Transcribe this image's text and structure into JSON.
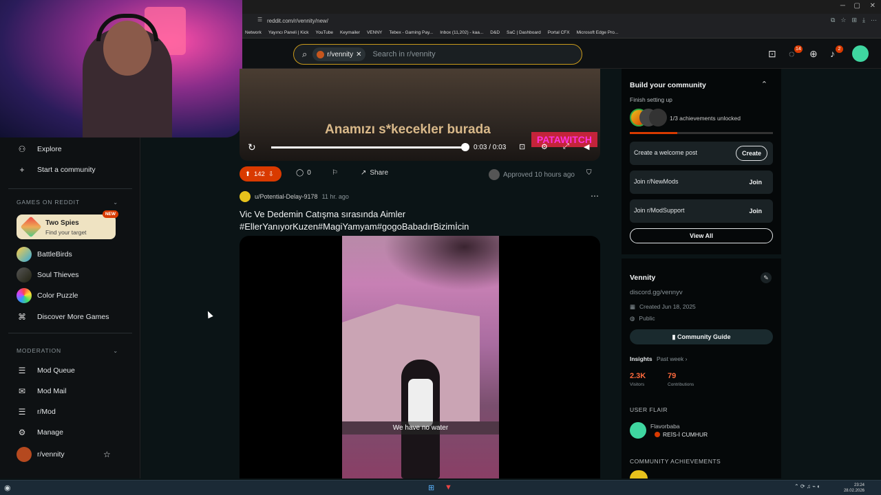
{
  "browser": {
    "url": "reddit.com/r/vennity/new/",
    "bookmarks": [
      "Network",
      "Yayıncı Paneli | Kick",
      "YouTube",
      "Keymailer",
      "VENNY",
      "Tebex - Gaming Pay...",
      "Inbox (11,202) - kaa...",
      "D&D",
      "SaC | Dashboard",
      "Portal CFX",
      "Microsoft Edge Pro..."
    ]
  },
  "header": {
    "community_chip": "r/vennity",
    "search_placeholder": "Search in r/vennity",
    "chat_badge": "14",
    "notif_badge": "2"
  },
  "sidebar": {
    "top_items": [
      {
        "label": "Explore",
        "icon": "explore-icon"
      },
      {
        "label": "Start a community",
        "icon": "plus-icon"
      }
    ],
    "games_header": "GAMES ON REDDIT",
    "featured_game": {
      "title": "Two Spies",
      "subtitle": "Find your target",
      "badge": "NEW"
    },
    "games": [
      "BattleBirds",
      "Soul Thieves",
      "Color Puzzle"
    ],
    "discover": "Discover More Games",
    "moderation_header": "MODERATION",
    "mod_items": [
      "Mod Queue",
      "Mod Mail",
      "r/Mod",
      "Manage",
      "r/vennity"
    ]
  },
  "video1": {
    "caption": "Anamızı s*kecekler burada",
    "watermark": "PATAWITCH",
    "time": "0:03 / 0:03"
  },
  "actions": {
    "votes": "142",
    "comments": "0",
    "share": "Share",
    "approved": "Approved 10 hours ago"
  },
  "post2": {
    "author": "u/Potential-Delay-9178",
    "ago": "11 hr. ago",
    "title_line1": "Vic Ve Dedemin Catışma sırasında Aimler",
    "title_line2": "#EllerYanıyorKuzen#MagiYamyam#gogoBabadırBizimİcin",
    "subtitle": "We have no water"
  },
  "right_sidebar": {
    "build_title": "Build your community",
    "finish": "Finish setting up",
    "achievements": "1/3 achievements unlocked",
    "tasks": [
      {
        "label": "Create a welcome post",
        "button": "Create"
      },
      {
        "label": "Join r/NewMods",
        "button": "Join"
      },
      {
        "label": "Join r/ModSupport",
        "button": "Join"
      }
    ],
    "view_all": "View All",
    "community_name": "Vennity",
    "community_link": "discord.gg/vennyv",
    "created": "Created Jun 18, 2025",
    "visibility": "Public",
    "guide": "Community Guide",
    "insights": "Insights",
    "period": "Past week ›",
    "visitors_num": "2.3K",
    "visitors_lbl": "Visitors",
    "contrib_num": "79",
    "contrib_lbl": "Contributions",
    "user_flair_header": "USER FLAIR",
    "flair_user": "Flavorbaba",
    "flair_text": "REİS-İ CUMHUR",
    "achievements_header": "COMMUNITY ACHIEVEMENTS"
  },
  "taskbar": {
    "time": "23:24",
    "date": "28.02.2026"
  },
  "colors": {
    "accent": "#d93a00",
    "search_border": "#c99a1b",
    "stat": "#ff6a3d"
  }
}
